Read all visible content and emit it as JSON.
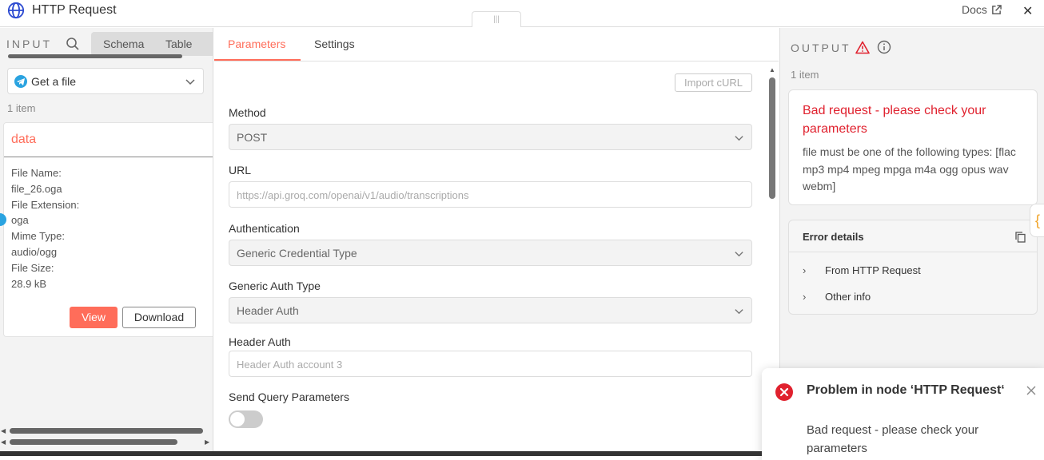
{
  "header": {
    "title": "HTTP Request",
    "docs_label": "Docs",
    "close_glyph": "✕",
    "drag_handle_glyph": "|||"
  },
  "input": {
    "label": "INPUT",
    "tabs": [
      "Schema",
      "Table"
    ],
    "node_select": {
      "value": "Get a file"
    },
    "item_count": "1 item",
    "card": {
      "key": "data",
      "fields": [
        {
          "label": "File Name:",
          "value": "file_26.oga"
        },
        {
          "label": "File Extension:",
          "value": "oga"
        },
        {
          "label": "Mime Type:",
          "value": "audio/ogg"
        },
        {
          "label": "File Size:",
          "value": "28.9 kB"
        }
      ],
      "view_label": "View",
      "download_label": "Download"
    }
  },
  "params": {
    "tabs": [
      "Parameters",
      "Settings"
    ],
    "import_label": "Import cURL",
    "method": {
      "label": "Method",
      "value": "POST"
    },
    "url": {
      "label": "URL",
      "placeholder": "https://api.groq.com/openai/v1/audio/transcriptions"
    },
    "authentication": {
      "label": "Authentication",
      "value": "Generic Credential Type"
    },
    "generic_auth": {
      "label": "Generic Auth Type",
      "value": "Header Auth"
    },
    "header_auth": {
      "label": "Header Auth",
      "placeholder": "Header Auth account 3"
    },
    "send_query": {
      "label": "Send Query Parameters",
      "enabled": false
    }
  },
  "output": {
    "label": "OUTPUT",
    "item_count": "1 item",
    "error": {
      "title": "Bad request - please check your parameters",
      "detail": "file must be one of the following types: [flac mp3 mp4 mpeg mpga m4a ogg opus wav webm]"
    },
    "details": {
      "title": "Error details",
      "rows": [
        "From HTTP Request",
        "Other info"
      ]
    },
    "side_tab_glyph": "{"
  },
  "toast": {
    "title": "Problem in node ‘HTTP Request‘",
    "message": "Bad request - please check your parameters"
  },
  "colors": {
    "accent": "#ff6d5a",
    "error": "#e0212e",
    "telegram": "#2aa3e0"
  }
}
